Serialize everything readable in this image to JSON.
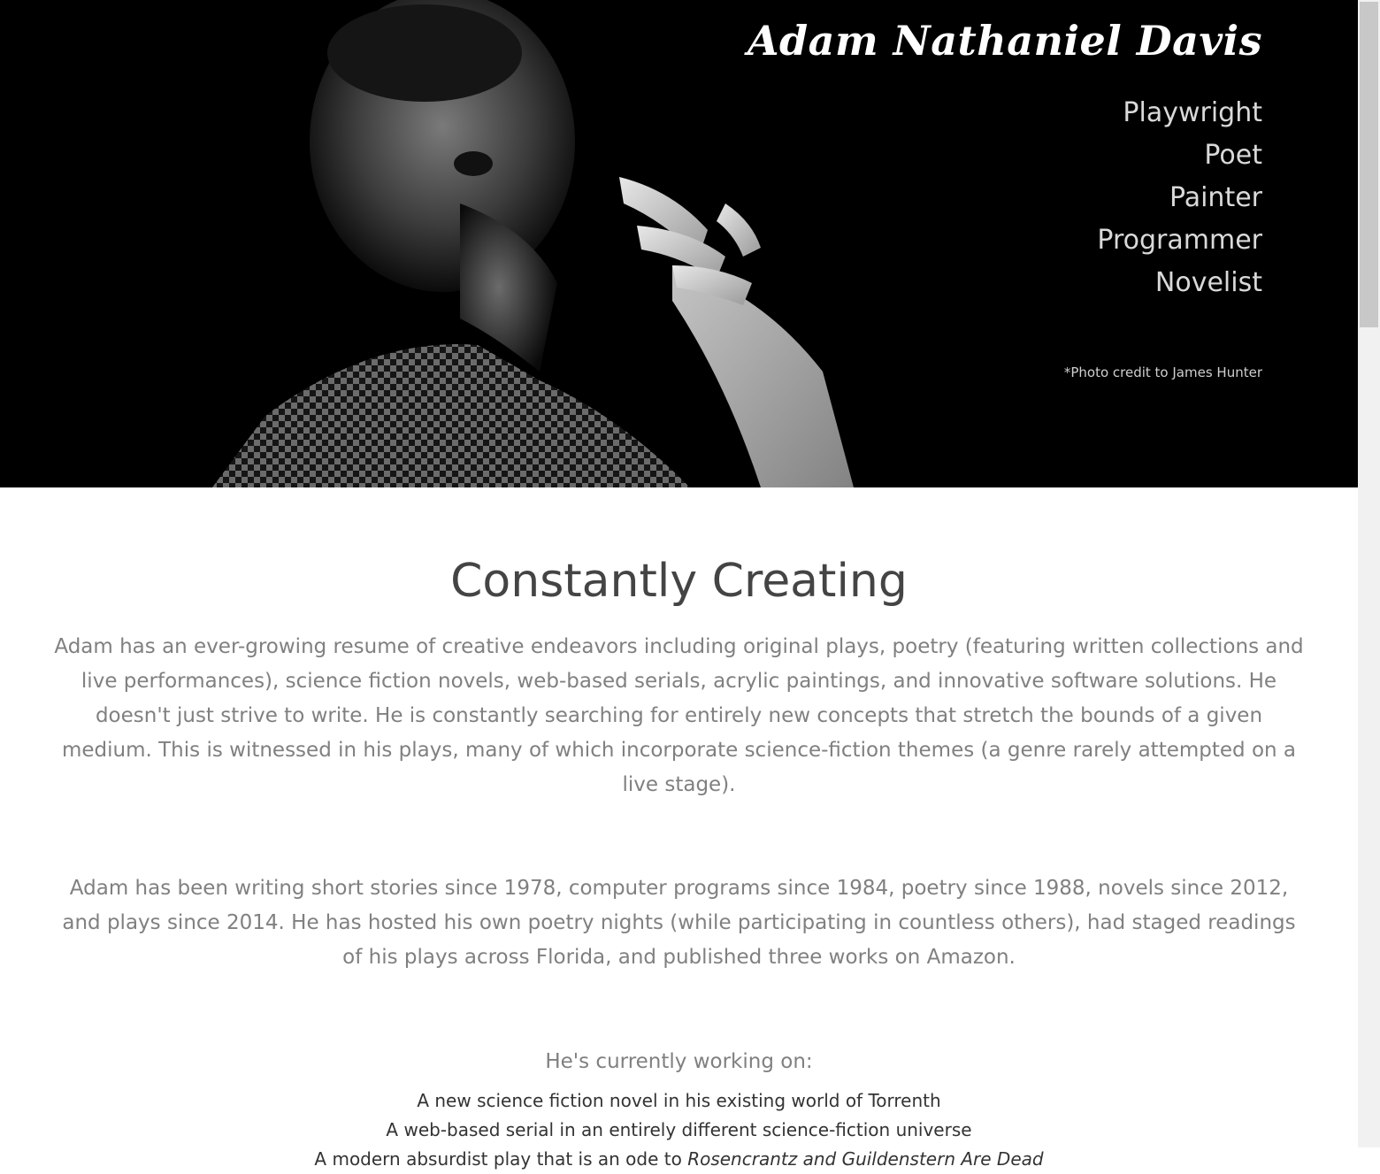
{
  "hero": {
    "title": "Adam Nathaniel Davis",
    "roles": [
      "Playwright",
      "Poet",
      "Painter",
      "Programmer",
      "Novelist"
    ],
    "photo_credit": "*Photo credit to James Hunter"
  },
  "main": {
    "heading": "Constantly Creating",
    "paragraph1": "Adam has an ever-growing resume of creative endeavors including original plays, poetry (featuring written collections and live performances), science fiction novels, web-based serials, acrylic paintings, and innovative software solutions.  He doesn't just strive to write.  He is constantly searching for entirely new concepts that stretch the bounds of a given medium.  This is witnessed in his plays, many of which incorporate science-fiction themes (a genre rarely attempted on a live stage).",
    "paragraph2": "Adam has been writing short stories since 1978, computer programs since 1984, poetry since 1988, novels since 2012, and plays since 2014.  He has hosted his own poetry nights (while participating in countless others), had staged readings of his plays across Florida, and published three works on Amazon.",
    "working_heading": "He's currently working on:",
    "works": [
      {
        "text": "A new science fiction novel in his existing world of Torrenth"
      },
      {
        "text": "A web-based serial in an entirely different science-fiction universe"
      },
      {
        "text": "A modern absurdist play that is an ode to ",
        "italic": "Rosencrantz and Guildenstern Are Dead"
      }
    ]
  }
}
